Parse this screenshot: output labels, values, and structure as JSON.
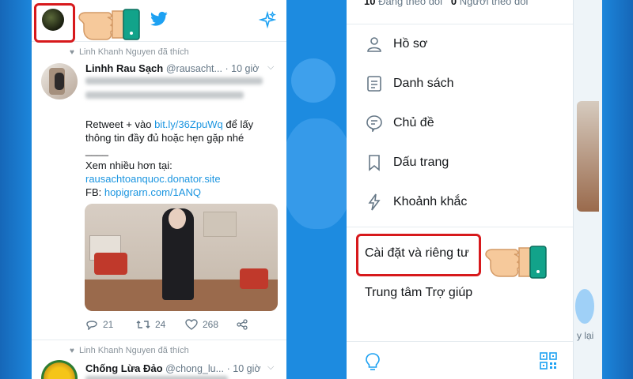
{
  "left": {
    "header": {
      "avatar": "profile-avatar",
      "logo": "twitter-bird-icon",
      "sparkle": "sparkle-icon"
    },
    "tweets": [
      {
        "liked_by": "Linh Khanh Nguyen đã thích",
        "name": "Linhh Rau Sạch",
        "handle": "@rausacht...",
        "time": "· 10 giờ",
        "text_line1_prefix": "Retweet + vào ",
        "text_line1_link": "bit.ly/36ZpuWq",
        "text_line1_suffix": " để lấy",
        "text_line2": "thông tin đầy đủ hoặc hẹn gặp nhé",
        "text_line3": "____",
        "text_line4": "Xem nhiều hơn tại:",
        "text_line5_link": "rausachtoanquoc.donator.site",
        "text_line6_prefix": "FB: ",
        "text_line6_link": "hopigrarn.com/1ANQ",
        "replies": "21",
        "retweets": "24",
        "likes": "268"
      },
      {
        "liked_by": "Linh Khanh Nguyen đã thích",
        "name": "Chống Lừa Đảo",
        "handle": "@chong_lu...",
        "time": "· 10 giờ"
      }
    ]
  },
  "right": {
    "follow_line": {
      "following_count": "10",
      "following_label": "Đang theo dõi",
      "followers_count": "0",
      "followers_label": "Người theo dõi"
    },
    "menu": [
      {
        "label": "Hồ sơ",
        "icon": "profile-icon"
      },
      {
        "label": "Danh sách",
        "icon": "list-icon"
      },
      {
        "label": "Chủ đề",
        "icon": "topics-icon"
      },
      {
        "label": "Dấu trang",
        "icon": "bookmark-icon"
      },
      {
        "label": "Khoảnh khắc",
        "icon": "moments-icon"
      }
    ],
    "settings_label": "Cài đặt và riêng tư",
    "help_label": "Trung tâm Trợ giúp",
    "peek_text": "y lại"
  },
  "colors": {
    "twitter_blue": "#1da1f2",
    "highlight_red": "#d7191c",
    "link": "#1b95e0"
  }
}
